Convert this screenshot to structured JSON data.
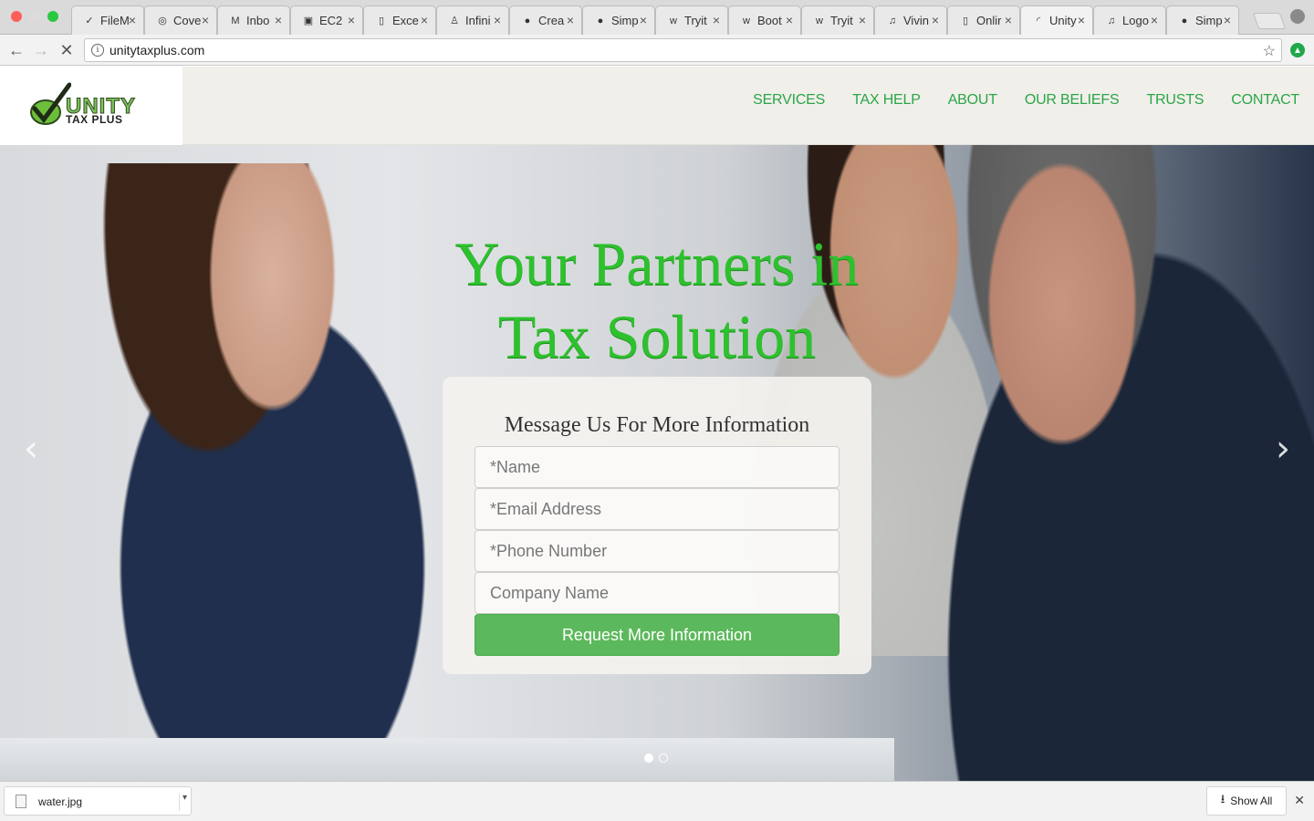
{
  "browser": {
    "tabs": [
      {
        "label": "FileM",
        "icon": "check-icon"
      },
      {
        "label": "Cove",
        "icon": "cover-icon"
      },
      {
        "label": "Inbo",
        "icon": "gmail-icon"
      },
      {
        "label": "EC2",
        "icon": "aws-icon"
      },
      {
        "label": "Exce",
        "icon": "page-icon"
      },
      {
        "label": "Infini",
        "icon": "linux-icon"
      },
      {
        "label": "Crea",
        "icon": "drop-icon"
      },
      {
        "label": "Simp",
        "icon": "drop-icon"
      },
      {
        "label": "Tryit",
        "icon": "w3-icon"
      },
      {
        "label": "Boot",
        "icon": "w3-icon"
      },
      {
        "label": "Tryit",
        "icon": "w3-icon"
      },
      {
        "label": "Vivin",
        "icon": "headphones-icon"
      },
      {
        "label": "Onlir",
        "icon": "page-icon"
      },
      {
        "label": "Unity",
        "icon": "loading-icon",
        "active": true
      },
      {
        "label": "Logo",
        "icon": "headphones-icon"
      },
      {
        "label": "Simp",
        "icon": "drop-icon"
      }
    ],
    "url": "unitytaxplus.com"
  },
  "site": {
    "logo": {
      "name": "UNITY",
      "sub": "TAX PLUS"
    },
    "menu": [
      "SERVICES",
      "TAX HELP",
      "ABOUT",
      "OUR BELIEFS",
      "TRUSTS",
      "CONTACT"
    ],
    "headline_line1": "Your Partners in",
    "headline_line2": "Tax Solution",
    "form": {
      "title": "Message Us For More Information",
      "name_placeholder": "*Name",
      "email_placeholder": "*Email Address",
      "phone_placeholder": "*Phone Number",
      "company_placeholder": "Company Name",
      "submit_label": "Request More Information"
    },
    "carousel_slides": 2,
    "active_slide": 1
  },
  "downloads": {
    "file_name": "water.jpg",
    "show_all": "Show All"
  },
  "colors": {
    "brand_green": "#2aa54a",
    "headline_green": "#2ec12e",
    "button_green": "#5cb85c"
  }
}
